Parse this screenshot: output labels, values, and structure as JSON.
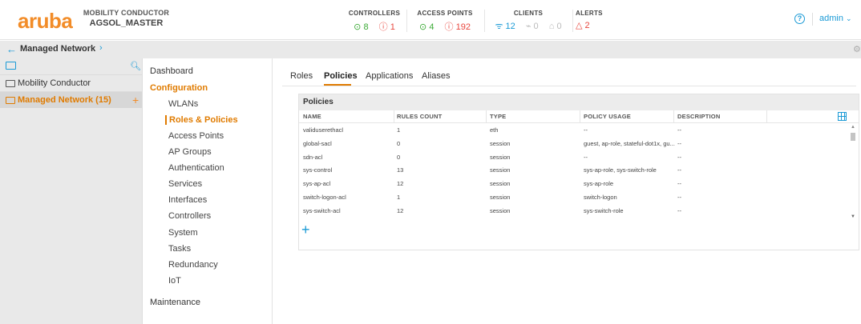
{
  "header": {
    "logo": "aruba",
    "product": "MOBILITY CONDUCTOR",
    "device": "AGSOL_MASTER",
    "stats": {
      "controllers": {
        "label": "CONTROLLERS",
        "ok": "8",
        "err": "1"
      },
      "access_points": {
        "label": "ACCESS POINTS",
        "ok": "4",
        "err": "192"
      },
      "clients": {
        "label": "CLIENTS",
        "wireless": "12",
        "wired": "0",
        "other": "0"
      },
      "alerts": {
        "label": "ALERTS",
        "count": "2"
      }
    },
    "user": "admin"
  },
  "breadcrumb": {
    "title": "Managed Network"
  },
  "sidebar": {
    "items": [
      {
        "label": "Mobility Conductor"
      },
      {
        "label": "Managed Network (15)"
      }
    ]
  },
  "nav": {
    "dashboard": "Dashboard",
    "configuration": "Configuration",
    "items": [
      "WLANs",
      "Roles & Policies",
      "Access Points",
      "AP Groups",
      "Authentication",
      "Services",
      "Interfaces",
      "Controllers",
      "System",
      "Tasks",
      "Redundancy",
      "IoT"
    ],
    "maintenance": "Maintenance"
  },
  "tabs": [
    "Roles",
    "Policies",
    "Applications",
    "Aliases"
  ],
  "policies": {
    "title": "Policies",
    "columns": [
      "NAME",
      "RULES COUNT",
      "TYPE",
      "POLICY USAGE",
      "DESCRIPTION"
    ],
    "rows": [
      [
        "validuserethacl",
        "1",
        "eth",
        "--",
        "--"
      ],
      [
        "global-sacl",
        "0",
        "session",
        "guest, ap-role, stateful-dot1x, gu...",
        "--"
      ],
      [
        "sdn-acl",
        "0",
        "session",
        "--",
        "--"
      ],
      [
        "sys-control",
        "13",
        "session",
        "sys-ap-role, sys-switch-role",
        "--"
      ],
      [
        "sys-ap-acl",
        "12",
        "session",
        "sys-ap-role",
        "--"
      ],
      [
        "switch-logon-acl",
        "1",
        "session",
        "switch-logon",
        "--"
      ],
      [
        "sys-switch-acl",
        "12",
        "session",
        "sys-switch-role",
        "--"
      ]
    ]
  }
}
